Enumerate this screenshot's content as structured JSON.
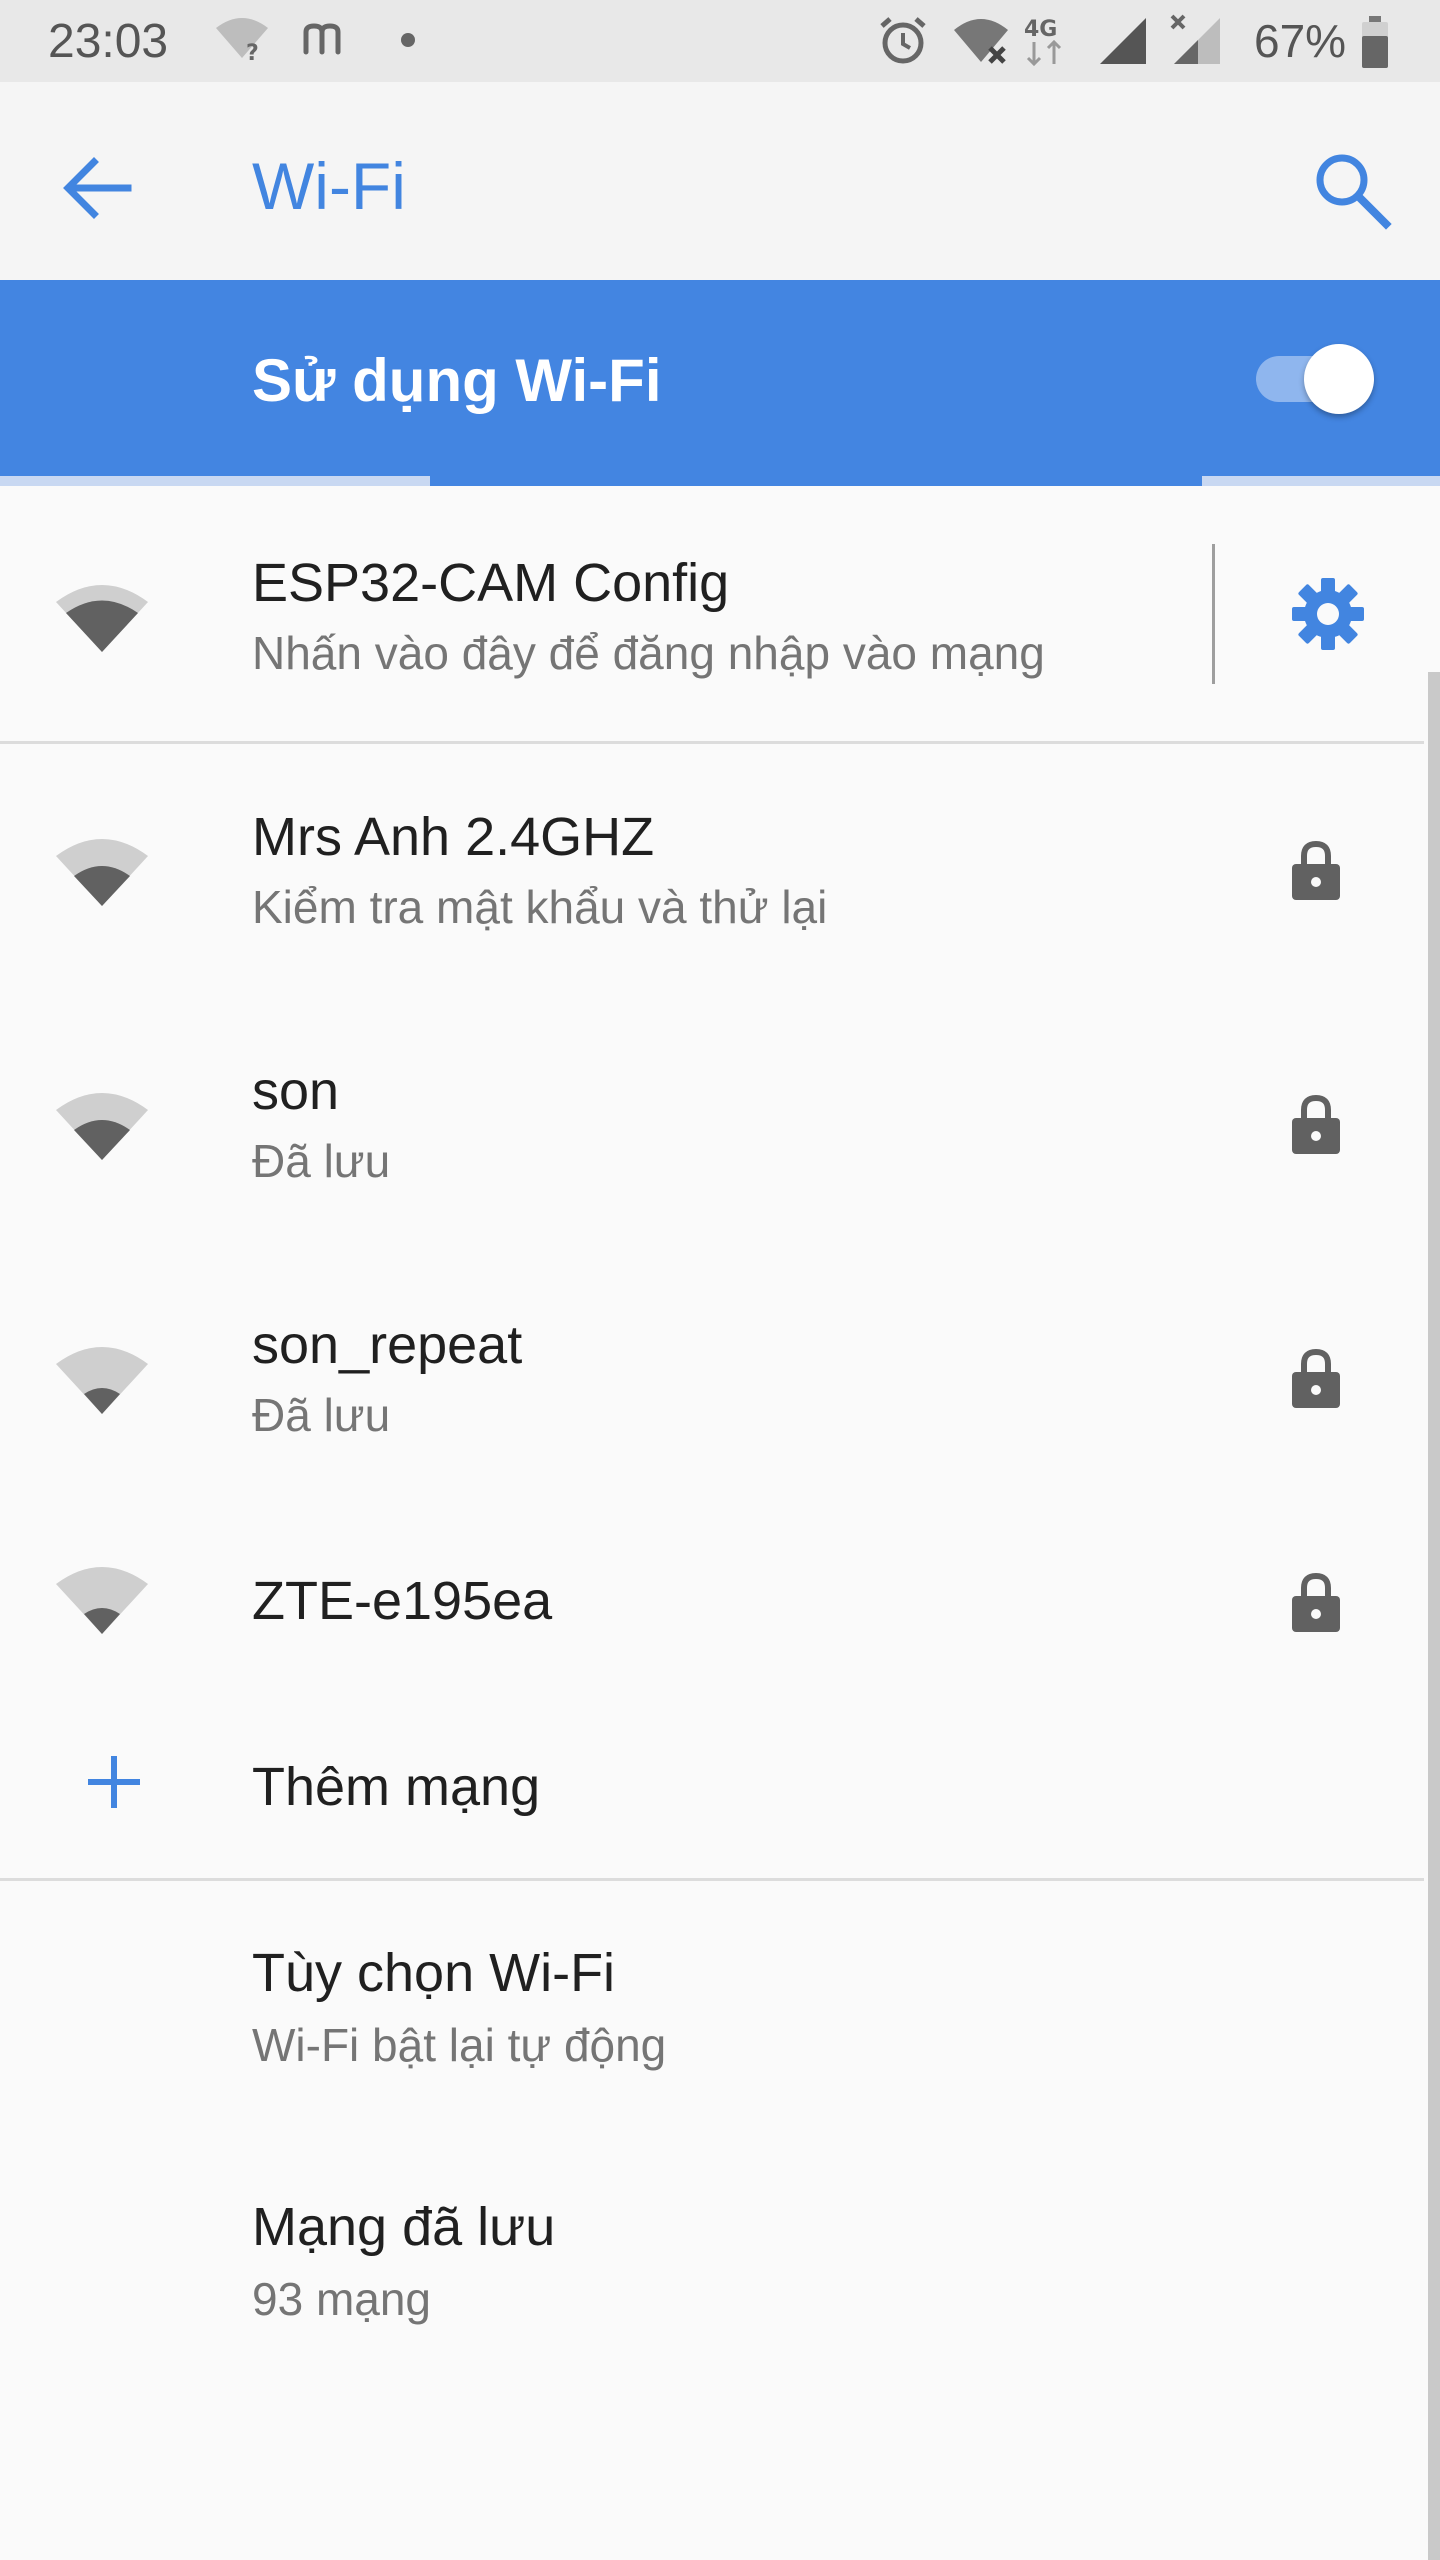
{
  "status_bar": {
    "time": "23:03",
    "battery_percent": "67%",
    "icons": [
      "wifi-unknown-icon",
      "m-app-icon",
      "dot-icon",
      "alarm-icon",
      "wifi-no-internet-icon",
      "4g-icon",
      "signal-icon",
      "signal-no-data-icon",
      "battery-icon"
    ]
  },
  "app_bar": {
    "title": "Wi-Fi",
    "back_icon": "arrow-back-icon",
    "search_icon": "search-icon"
  },
  "master_switch": {
    "label": "Sử dụng Wi-Fi",
    "state": "on"
  },
  "networks": [
    {
      "name": "ESP32-CAM Config",
      "status": "Nhấn vào đây để đăng nhập vào mạng",
      "secured": false,
      "signal_bars": 3
    },
    {
      "name": "Mrs Anh 2.4GHZ",
      "status": "Kiểm tra mật khẩu và thử lại",
      "secured": true,
      "signal_bars": 2
    },
    {
      "name": "son",
      "status": "Đã lưu",
      "secured": true,
      "signal_bars": 2
    },
    {
      "name": "son_repeat",
      "status": "Đã lưu",
      "secured": true,
      "signal_bars": 1
    },
    {
      "name": "ZTE-e195ea",
      "status": "",
      "secured": true,
      "signal_bars": 1
    }
  ],
  "add_network": {
    "label": "Thêm mạng",
    "icon": "plus-icon"
  },
  "preferences": [
    {
      "title": "Tùy chọn Wi-Fi",
      "summary": "Wi-Fi bật lại tự động"
    },
    {
      "title": "Mạng đã lưu",
      "summary": "93 mạng"
    }
  ],
  "colors": {
    "accent": "#4285e0",
    "header_blue": "#4385e1",
    "icon_gray": "#616161",
    "icon_light": "#cfcfcf"
  }
}
